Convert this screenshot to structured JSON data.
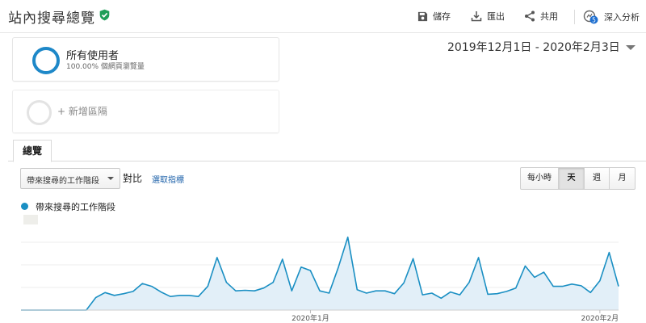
{
  "header": {
    "title": "站內搜尋總覽",
    "save_label": "儲存",
    "export_label": "匯出",
    "share_label": "共用",
    "insights_label": "深入分析",
    "insights_count": "5"
  },
  "segments": {
    "all_users_name": "所有使用者",
    "all_users_sub": "100.00% 個網頁瀏覽量",
    "add_segment_label": "+ 新增區隔"
  },
  "date_range": "2019年12月1日 - 2020年2月3日",
  "tabs": [
    {
      "label": "總覽"
    }
  ],
  "metric": {
    "select_value": "帶來搜尋的工作階段",
    "compare_label": "對比",
    "choose_metric_label": "選取指標"
  },
  "granularity": {
    "hourly": "每小時",
    "day": "天",
    "week": "週",
    "month": "月",
    "active": "day"
  },
  "colors": {
    "series_line": "#1a8fc3",
    "series_fill": "#e2eff8",
    "ring_all_users": "#1e88c8",
    "verified": "#1e9e58",
    "link": "#1a5fa8"
  },
  "chart_data": {
    "type": "area",
    "series": [
      {
        "name": "帶來搜尋的工作階段",
        "values": [
          0,
          0,
          0,
          0,
          0,
          0,
          0,
          0,
          2.2,
          3.1,
          2.6,
          2.9,
          3.3,
          4.7,
          4.2,
          3.2,
          2.4,
          2.6,
          2.6,
          2.4,
          4.2,
          9.3,
          4.9,
          3.4,
          3.5,
          3.4,
          3.9,
          4.9,
          9.0,
          3.4,
          7.6,
          7.0,
          3.4,
          3.0,
          7.6,
          12.9,
          3.6,
          3.0,
          3.4,
          3.4,
          2.9,
          4.8,
          9.1,
          2.7,
          3.0,
          2.1,
          3.2,
          2.7,
          4.9,
          9.3,
          2.8,
          2.9,
          3.3,
          3.9,
          7.8,
          5.8,
          6.7,
          4.2,
          4.2,
          4.6,
          4.3,
          3.1,
          5.2,
          10.2,
          4.2
        ]
      }
    ],
    "x_tick_labels": [
      "2020年1月",
      "2020年2月"
    ],
    "x_tick_indices": [
      31,
      62
    ],
    "ylim": [
      0,
      16
    ],
    "grid": true,
    "legend": "top-left"
  }
}
